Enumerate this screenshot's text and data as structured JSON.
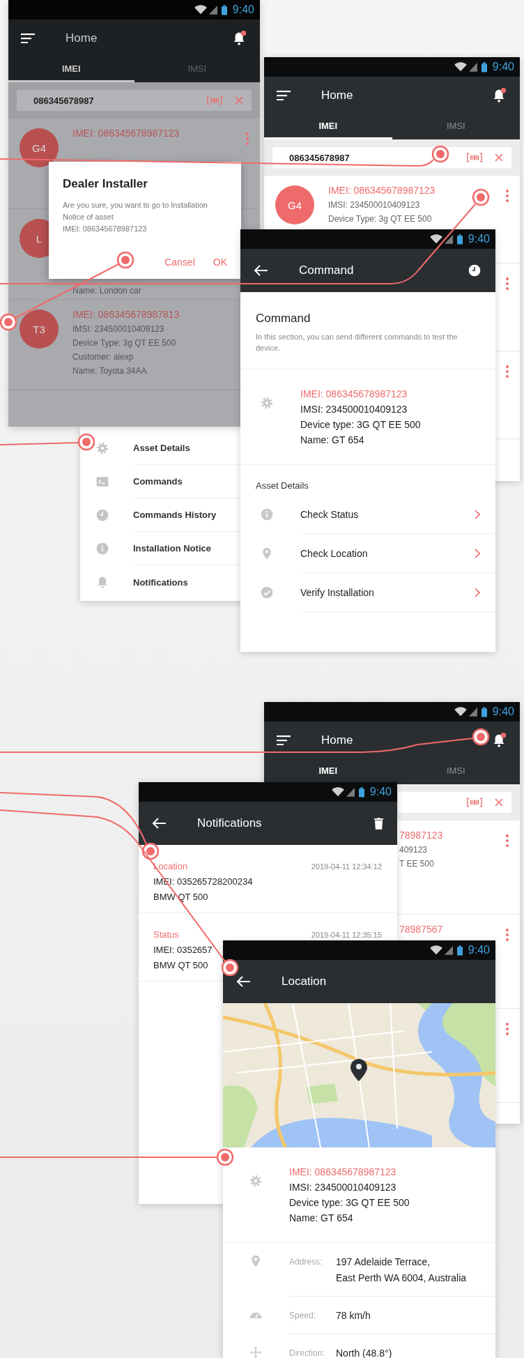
{
  "home_screens": [
    {
      "dimmed": true,
      "status_time": "9:40",
      "title": "Home",
      "tabs": [
        {
          "label": "IMEI",
          "selected": true
        },
        {
          "label": "IMSI",
          "selected": false
        }
      ],
      "search": {
        "value": "086345678987"
      },
      "items": [
        {
          "avatar": "G4",
          "imei": "IMEI: 086345678987123",
          "menu_icon": true
        },
        {
          "avatar": "L",
          "lines": [
            "Name: London car"
          ],
          "menu_icon": false
        },
        {
          "avatar": "T3",
          "imei": "IMEI: 086345678987813",
          "lines": [
            "IMSI: 234500010409123",
            "Device Type: 3g QT EE 500",
            "Customer: alexp",
            "Name: Toyota 34AA"
          ],
          "menu_icon": false
        }
      ],
      "dialog": {
        "title": "Dealer Installer",
        "message": "Are you sure, you want to go to Installation Notice of asset",
        "detail": "IMEI: 086345678987123",
        "buttons": [
          "Cansel",
          "OK"
        ]
      }
    },
    {
      "dimmed": false,
      "status_time": "9:40",
      "title": "Home",
      "tabs": [
        {
          "label": "IMEI",
          "selected": true
        },
        {
          "label": "IMSI",
          "selected": false
        }
      ],
      "search": {
        "value": "086345678987"
      },
      "items": [
        {
          "avatar": "G4",
          "imei": "IMEI: 086345678987123",
          "lines": [
            "IMSI: 234500010409123",
            "Device Type: 3g QT EE 500"
          ],
          "menu_icon": true
        },
        {
          "menu_icon": true
        },
        {
          "menu_icon": true
        }
      ]
    },
    {
      "dimmed": false,
      "status_time": "9:40",
      "title": "Home",
      "tabs": [
        {
          "label": "IMEI",
          "selected": true
        },
        {
          "label": "IMSI",
          "selected": false
        }
      ],
      "items": [
        {
          "imei": "78987123",
          "lines": [
            "409123",
            "T EE 500"
          ],
          "menu_icon": true
        },
        {
          "imei": "78987567",
          "menu_icon": true
        },
        {
          "menu_icon": true
        }
      ]
    }
  ],
  "menu": {
    "items": [
      {
        "label": "Asset Details"
      },
      {
        "label": "Commands"
      },
      {
        "label": "Commands History"
      },
      {
        "label": "Installation Notice"
      },
      {
        "label": "Notifications"
      }
    ]
  },
  "command": {
    "status_time": "9:40",
    "title": "Command",
    "heading": "Command",
    "description": "In this section, you can send different commands to test the device.",
    "device": {
      "imei": "IMEI: 086345678987123",
      "lines": [
        "IMSI: 234500010409123",
        "Device type: 3G QT EE 500",
        "Name: GT 654"
      ]
    },
    "section": "Asset Details",
    "actions": [
      {
        "label": "Check Status"
      },
      {
        "label": "Check Location"
      },
      {
        "label": "Verify Installation"
      }
    ]
  },
  "notifications": {
    "status_time": "9:40",
    "title": "Notifications",
    "items": [
      {
        "type": "Location",
        "time": "2019-04-11 12:34:12",
        "imei": "IMEI: 035265728200234",
        "name": "BMW QT 500"
      },
      {
        "type": "Status",
        "time": "2019-04-11 12:35:15",
        "imei": "IMEI: 0352657",
        "name": "BMW QT 500"
      }
    ]
  },
  "location": {
    "status_time": "9:40",
    "title": "Location",
    "device": {
      "imei": "IMEI: 086345678987123",
      "lines": [
        "IMSI: 234500010409123",
        "Device type: 3G QT EE 500",
        "Name: GT 654"
      ]
    },
    "details": [
      {
        "label": "Address:",
        "value": "197 Adelaide Terrace,\nEast Perth WA 6004, Australia"
      },
      {
        "label": "Speed:",
        "value": "78 km/h"
      },
      {
        "label": "Direction:",
        "value": "North (48.8°)"
      }
    ]
  }
}
